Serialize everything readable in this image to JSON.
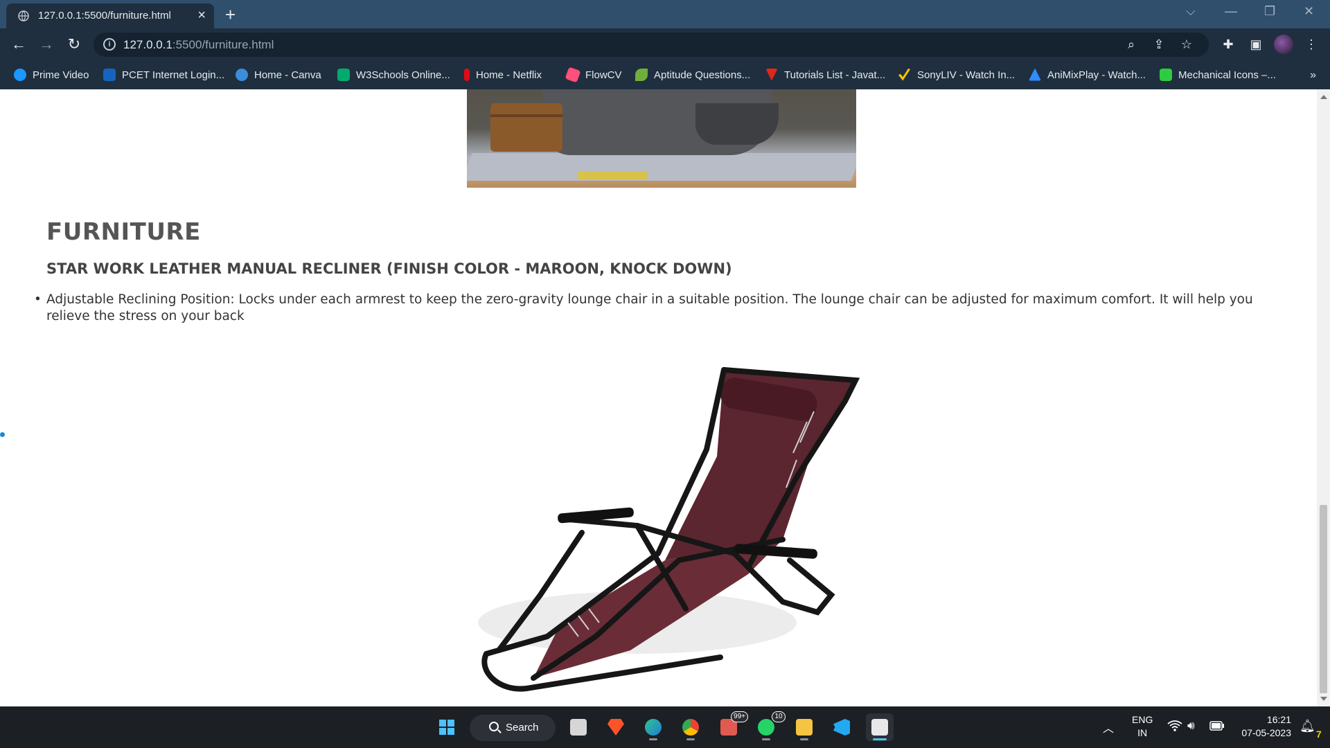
{
  "browser": {
    "tab_title": "127.0.0.1:5500/furniture.html",
    "url_host": "127.0.0.1",
    "url_path": ":5500/furniture.html",
    "bookmarks": [
      {
        "label": "Prime Video",
        "icon": "prime-video-icon",
        "color": "#1a98ff"
      },
      {
        "label": "PCET Internet Login...",
        "icon": "pcet-icon",
        "color": "#1565c0"
      },
      {
        "label": "Home - Canva",
        "icon": "canva-icon",
        "color": "#3a8ddb"
      },
      {
        "label": "W3Schools Online...",
        "icon": "w3schools-icon",
        "color": "#04aa6d"
      },
      {
        "label": "Home - Netflix",
        "icon": "netflix-icon",
        "color": "#e50914"
      },
      {
        "label": "FlowCV",
        "icon": "flowcv-icon",
        "color": "#ff4f7b"
      },
      {
        "label": "Aptitude Questions...",
        "icon": "aptitude-icon",
        "color": "#6fae3b"
      },
      {
        "label": "Tutorials List - Javat...",
        "icon": "javatpoint-icon",
        "color": "#e1261c"
      },
      {
        "label": "SonyLIV - Watch In...",
        "icon": "sonyliv-icon",
        "color": "#f5c400"
      },
      {
        "label": "AniMixPlay - Watch...",
        "icon": "animixplay-icon",
        "color": "#2f8cff"
      },
      {
        "label": "Mechanical Icons –...",
        "icon": "mechanical-icons-icon",
        "color": "#2ecc40"
      }
    ],
    "more_bookmarks": "»"
  },
  "page": {
    "heading": "FURNITURE",
    "product_title": "STAR WORK LEATHER MANUAL RECLINER (FINISH COLOR - MAROON, KNOCK DOWN)",
    "features": [
      "Adjustable Reclining Position: Locks under each armrest to keep the zero-gravity lounge chair in a suitable position. The lounge chair can be adjusted for maximum comfort. It will help you relieve the stress on your back"
    ],
    "colors": {
      "heading": "#555555",
      "text": "#333333",
      "chair_fabric": "#5b2630"
    }
  },
  "taskbar": {
    "search_label": "Search",
    "mail_badge": "99+",
    "whatsapp_badge": "10",
    "lang_line1": "ENG",
    "lang_line2": "IN",
    "time": "16:21",
    "date": "07-05-2023",
    "notification_count": "7"
  }
}
